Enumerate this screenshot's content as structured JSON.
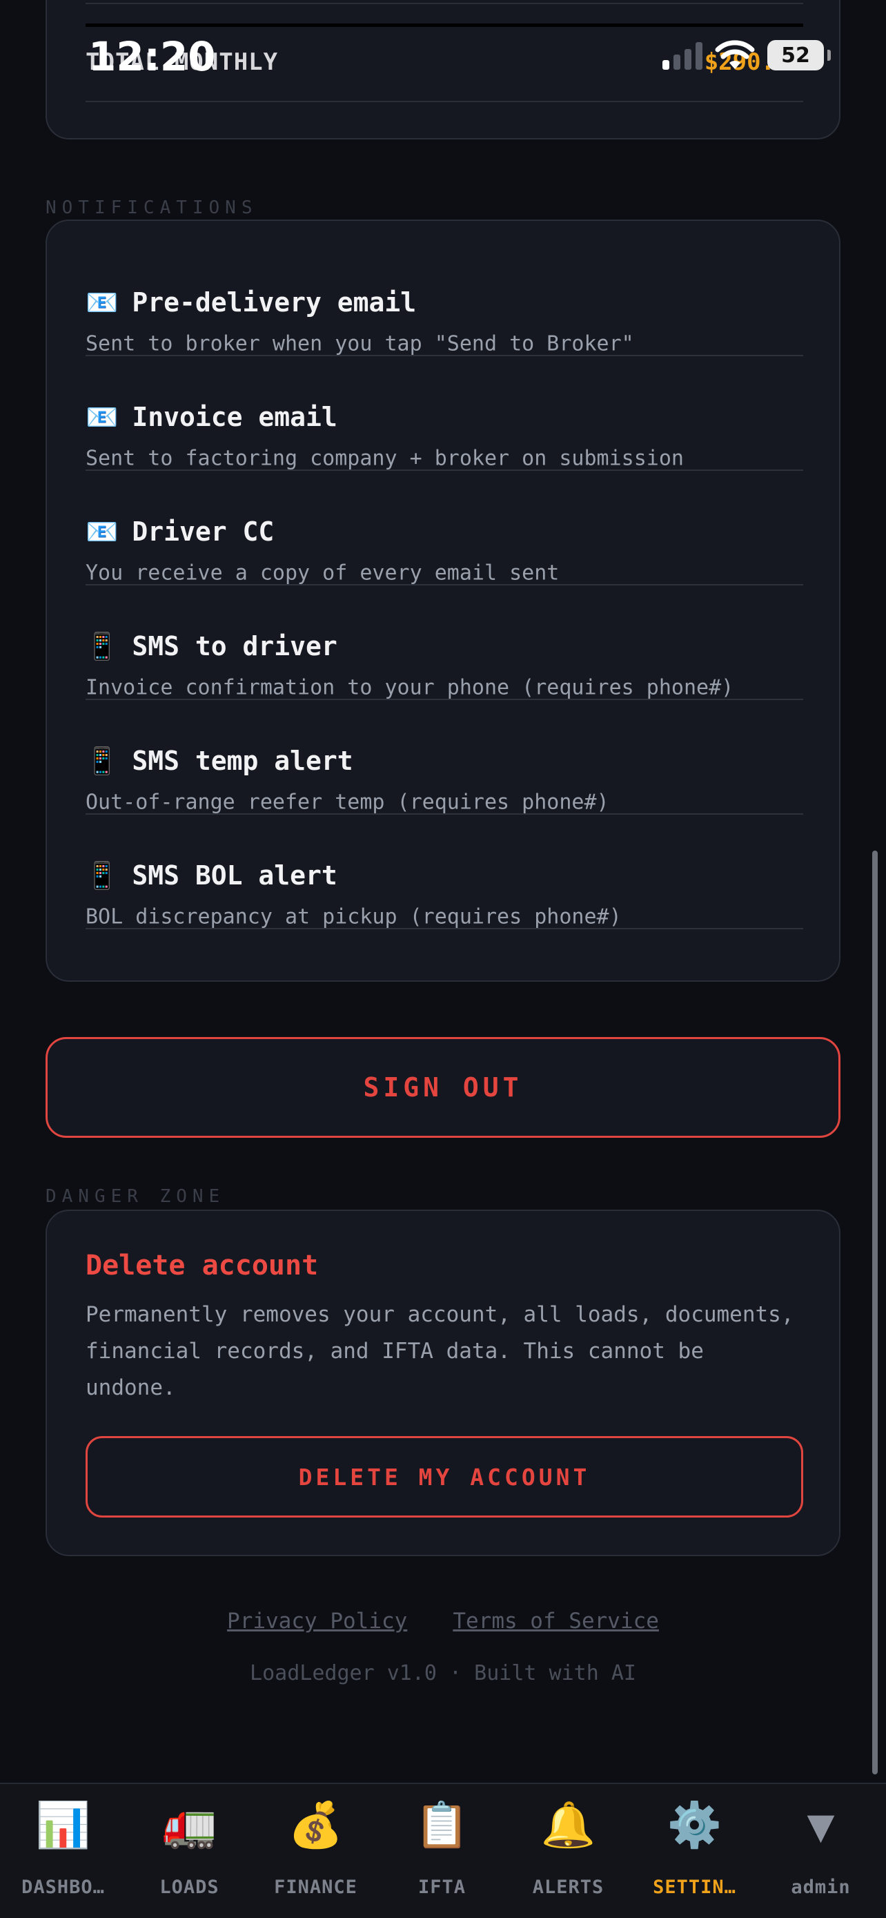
{
  "status_bar": {
    "time": "12:20",
    "battery": "52"
  },
  "summary": {
    "total_label": "TOTAL MONTHLY",
    "total_value": "$290.00"
  },
  "notifications": {
    "section_label": "NOTIFICATIONS",
    "items": [
      {
        "icon": "📧",
        "title": "Pre-delivery email",
        "desc": "Sent to broker when you tap \"Send to Broker\""
      },
      {
        "icon": "📧",
        "title": "Invoice email",
        "desc": "Sent to factoring company + broker on submission"
      },
      {
        "icon": "📧",
        "title": "Driver CC",
        "desc": "You receive a copy of every email sent"
      },
      {
        "icon": "📱",
        "title": "SMS to driver",
        "desc": "Invoice confirmation to your phone (requires phone#)"
      },
      {
        "icon": "📱",
        "title": "SMS temp alert",
        "desc": "Out-of-range reefer temp (requires phone#)"
      },
      {
        "icon": "📱",
        "title": "SMS BOL alert",
        "desc": "BOL discrepancy at pickup (requires phone#)"
      }
    ]
  },
  "sign_out": "SIGN OUT",
  "danger_zone": {
    "section_label": "DANGER ZONE",
    "title": "Delete account",
    "desc": "Permanently removes your account, all loads, documents, financial records, and IFTA data. This cannot be undone.",
    "button": "DELETE MY ACCOUNT"
  },
  "footer": {
    "privacy": "Privacy Policy",
    "terms": "Terms of Service",
    "version": "LoadLedger v1.0 · Built with AI"
  },
  "nav": {
    "items": [
      {
        "icon": "📊",
        "label": "DASHBO…"
      },
      {
        "icon": "🚛",
        "label": "LOADS"
      },
      {
        "icon": "💰",
        "label": "FINANCE"
      },
      {
        "icon": "📋",
        "label": "IFTA"
      },
      {
        "icon": "🔔",
        "label": "ALERTS"
      },
      {
        "icon": "⚙️",
        "label": "SETTIN…"
      },
      {
        "icon": "▼",
        "label": "admin"
      }
    ],
    "active_index": 5,
    "active_color": "#f0a21a"
  },
  "colors": {
    "background": "#0c0e13",
    "card": "#151820",
    "danger": "#e4463f",
    "accent": "#f0a21a"
  }
}
